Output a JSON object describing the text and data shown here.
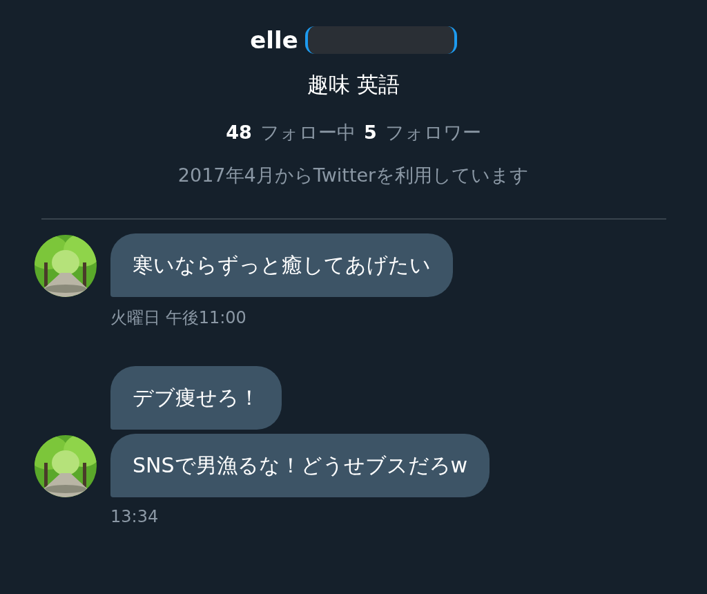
{
  "profile": {
    "name": "elle",
    "bio": "趣味 英語",
    "stats": [
      {
        "count": "48",
        "label": "フォロー中"
      },
      {
        "count": "5",
        "label": "フォロワー"
      }
    ],
    "joined": "2017年4月からTwitterを利用しています"
  },
  "message_groups": [
    {
      "messages": [
        "寒いならずっと癒してあげたい"
      ],
      "time": "火曜日 午後11:00"
    },
    {
      "messages": [
        "デブ痩せろ！",
        "SNSで男漁るな！どうせブスだろw"
      ],
      "time": "13:34"
    }
  ]
}
